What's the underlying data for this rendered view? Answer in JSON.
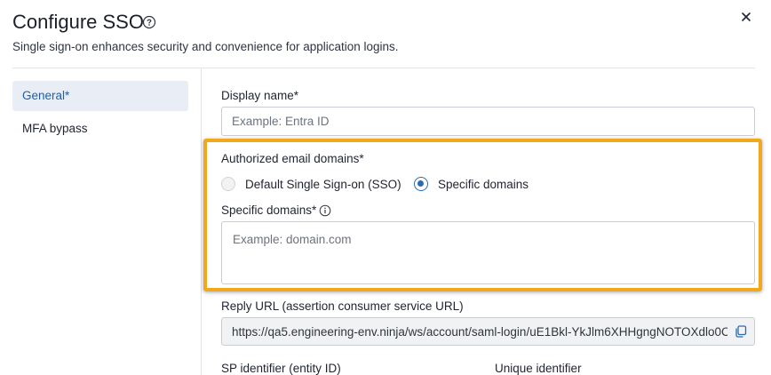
{
  "header": {
    "title": "Configure SSO",
    "subtitle": "Single sign-on enhances security and convenience for application logins."
  },
  "sidebar": {
    "items": [
      {
        "label": "General*",
        "active": true
      },
      {
        "label": "MFA bypass",
        "active": false
      }
    ]
  },
  "form": {
    "display_name": {
      "label": "Display name*",
      "placeholder": "Example: Entra ID",
      "value": ""
    },
    "authorized_domains": {
      "label": "Authorized email domains*",
      "options": [
        {
          "label": "Default Single Sign-on (SSO)",
          "selected": false
        },
        {
          "label": "Specific domains",
          "selected": true
        }
      ]
    },
    "specific_domains": {
      "label": "Specific domains*",
      "placeholder": "Example: domain.com",
      "value": ""
    },
    "reply_url": {
      "label": "Reply URL (assertion consumer service URL)",
      "value": "https://qa5.engineering-env.ninja/ws/account/saml-login/uE1Bkl-YkJlm6XHHgngNOTOXdlo0C"
    },
    "sp_identifier": {
      "label": "SP identifier (entity ID)"
    },
    "unique_identifier": {
      "label": "Unique identifier"
    }
  },
  "colors": {
    "accent": "#2b6cb0",
    "highlight": "#f2a81d",
    "active_bg": "#e9eef6"
  },
  "icons": {
    "help": "help-circle-icon",
    "close": "close-icon",
    "info": "info-icon",
    "copy": "copy-icon"
  }
}
